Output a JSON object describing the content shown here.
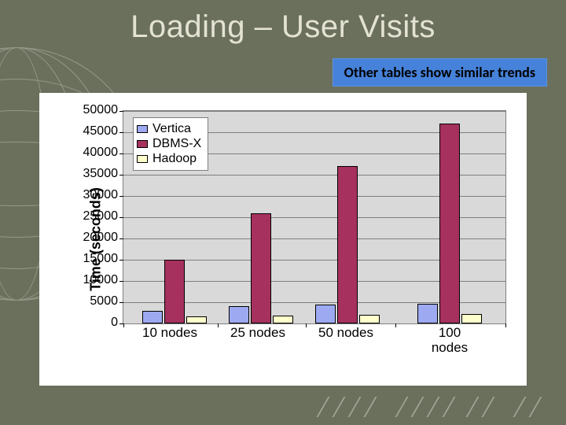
{
  "title": "Loading – User Visits",
  "note": "Other tables show similar trends",
  "ylabel": "Time (seconds)",
  "chart_data": {
    "type": "bar",
    "categories": [
      "10 nodes",
      "25 nodes",
      "50 nodes",
      "100 nodes"
    ],
    "series": [
      {
        "name": "Vertica",
        "values": [
          3000,
          4000,
          4400,
          4600
        ]
      },
      {
        "name": "DBMS-X",
        "values": [
          15000,
          26000,
          37000,
          47000
        ]
      },
      {
        "name": "Hadoop",
        "values": [
          1600,
          1900,
          2000,
          2200
        ]
      }
    ],
    "ylabel": "Time (seconds)",
    "ylim": [
      0,
      50000
    ],
    "ytick": 5000,
    "title": "Loading – User Visits"
  },
  "yTicks": [
    "0",
    "5000",
    "10000",
    "15000",
    "20000",
    "25000",
    "30000",
    "35000",
    "40000",
    "45000",
    "50000"
  ],
  "legend": {
    "s1": "Vertica",
    "s2": "DBMS-X",
    "s3": "Hadoop"
  },
  "xcats": {
    "c1": "10 nodes",
    "c2": "25 nodes",
    "c3": "50 nodes",
    "c4": "100\nnodes"
  }
}
